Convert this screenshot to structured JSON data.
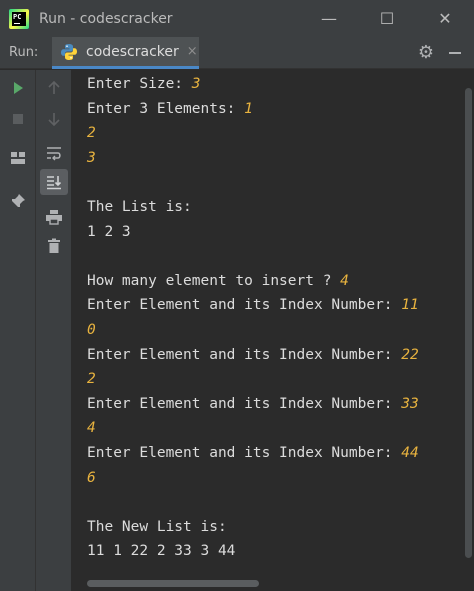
{
  "window": {
    "title": "Run - codescracker",
    "app_icon_text": "PC",
    "minimize_glyph": "—",
    "maximize_glyph": "☐",
    "close_glyph": "✕"
  },
  "run_panel": {
    "label": "Run:",
    "tab_name": "codescracker",
    "tab_close_glyph": "×",
    "settings_glyph": "⚙"
  },
  "console": {
    "lines": [
      {
        "text": "Enter Size: ",
        "input": "3"
      },
      {
        "text": "Enter 3 Elements: ",
        "input": "1"
      },
      {
        "text": "",
        "input": "2"
      },
      {
        "text": "",
        "input": "3"
      },
      {
        "text": "",
        "input": ""
      },
      {
        "text": "The List is:",
        "input": ""
      },
      {
        "text": "1 2 3",
        "input": ""
      },
      {
        "text": "",
        "input": ""
      },
      {
        "text": "How many element to insert ? ",
        "input": "4"
      },
      {
        "text": "Enter Element and its Index Number: ",
        "input": "11"
      },
      {
        "text": "",
        "input": "0"
      },
      {
        "text": "Enter Element and its Index Number: ",
        "input": "22"
      },
      {
        "text": "",
        "input": "2"
      },
      {
        "text": "Enter Element and its Index Number: ",
        "input": "33"
      },
      {
        "text": "",
        "input": "4"
      },
      {
        "text": "Enter Element and its Index Number: ",
        "input": "44"
      },
      {
        "text": "",
        "input": "6"
      },
      {
        "text": "",
        "input": ""
      },
      {
        "text": "The New List is:",
        "input": ""
      },
      {
        "text": "11 1 22 2 33 3 44",
        "input": ""
      }
    ]
  },
  "toolbar": {
    "icons": [
      "rerun-icon",
      "stop-icon",
      "layout-icon",
      "pin-icon",
      "up-arrow-icon",
      "down-arrow-icon",
      "soft-wrap-icon",
      "scroll-to-end-icon",
      "print-icon",
      "trash-icon"
    ]
  },
  "colors": {
    "background": "#2b2b2b",
    "chrome": "#3c3f41",
    "console_text": "#dcdcdc",
    "user_input": "#e8b33f",
    "run_green": "#59a869"
  }
}
